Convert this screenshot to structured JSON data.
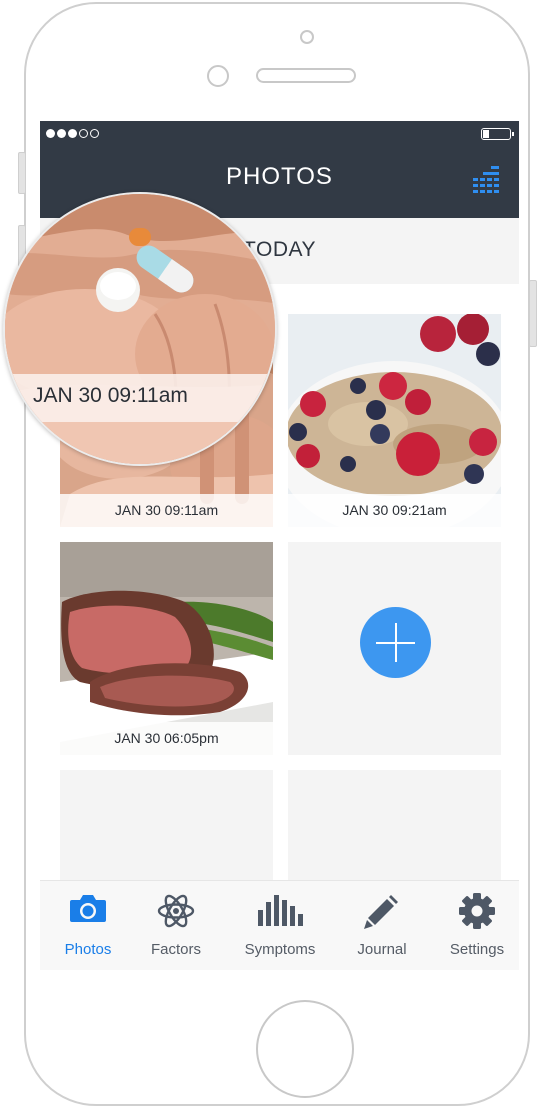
{
  "status_bar": {
    "signal_full": 3,
    "signal_total": 5
  },
  "header": {
    "title": "PHOTOS",
    "menu_icon": "menu-lines-icon"
  },
  "section": {
    "label": "TODAY"
  },
  "photos": [
    {
      "timestamp": "JAN 30 09:11am",
      "subject": "pills"
    },
    {
      "timestamp": "JAN 30 09:21am",
      "subject": "oatmeal-berries"
    },
    {
      "timestamp": "JAN 30 06:05pm",
      "subject": "roast-beef"
    }
  ],
  "add_button_icon": "plus-icon",
  "magnifier": {
    "timestamp": "JAN 30 09:11am"
  },
  "tabs": [
    {
      "label": "Photos",
      "icon": "camera-icon",
      "active": true
    },
    {
      "label": "Factors",
      "icon": "atom-icon",
      "active": false
    },
    {
      "label": "Symptoms",
      "icon": "bars-icon",
      "active": false
    },
    {
      "label": "Journal",
      "icon": "pencil-icon",
      "active": false
    },
    {
      "label": "Settings",
      "icon": "gear-icon",
      "active": false
    }
  ],
  "colors": {
    "header_bg": "#323a45",
    "accent": "#1a7ee8",
    "add_button": "#3d97f0"
  }
}
